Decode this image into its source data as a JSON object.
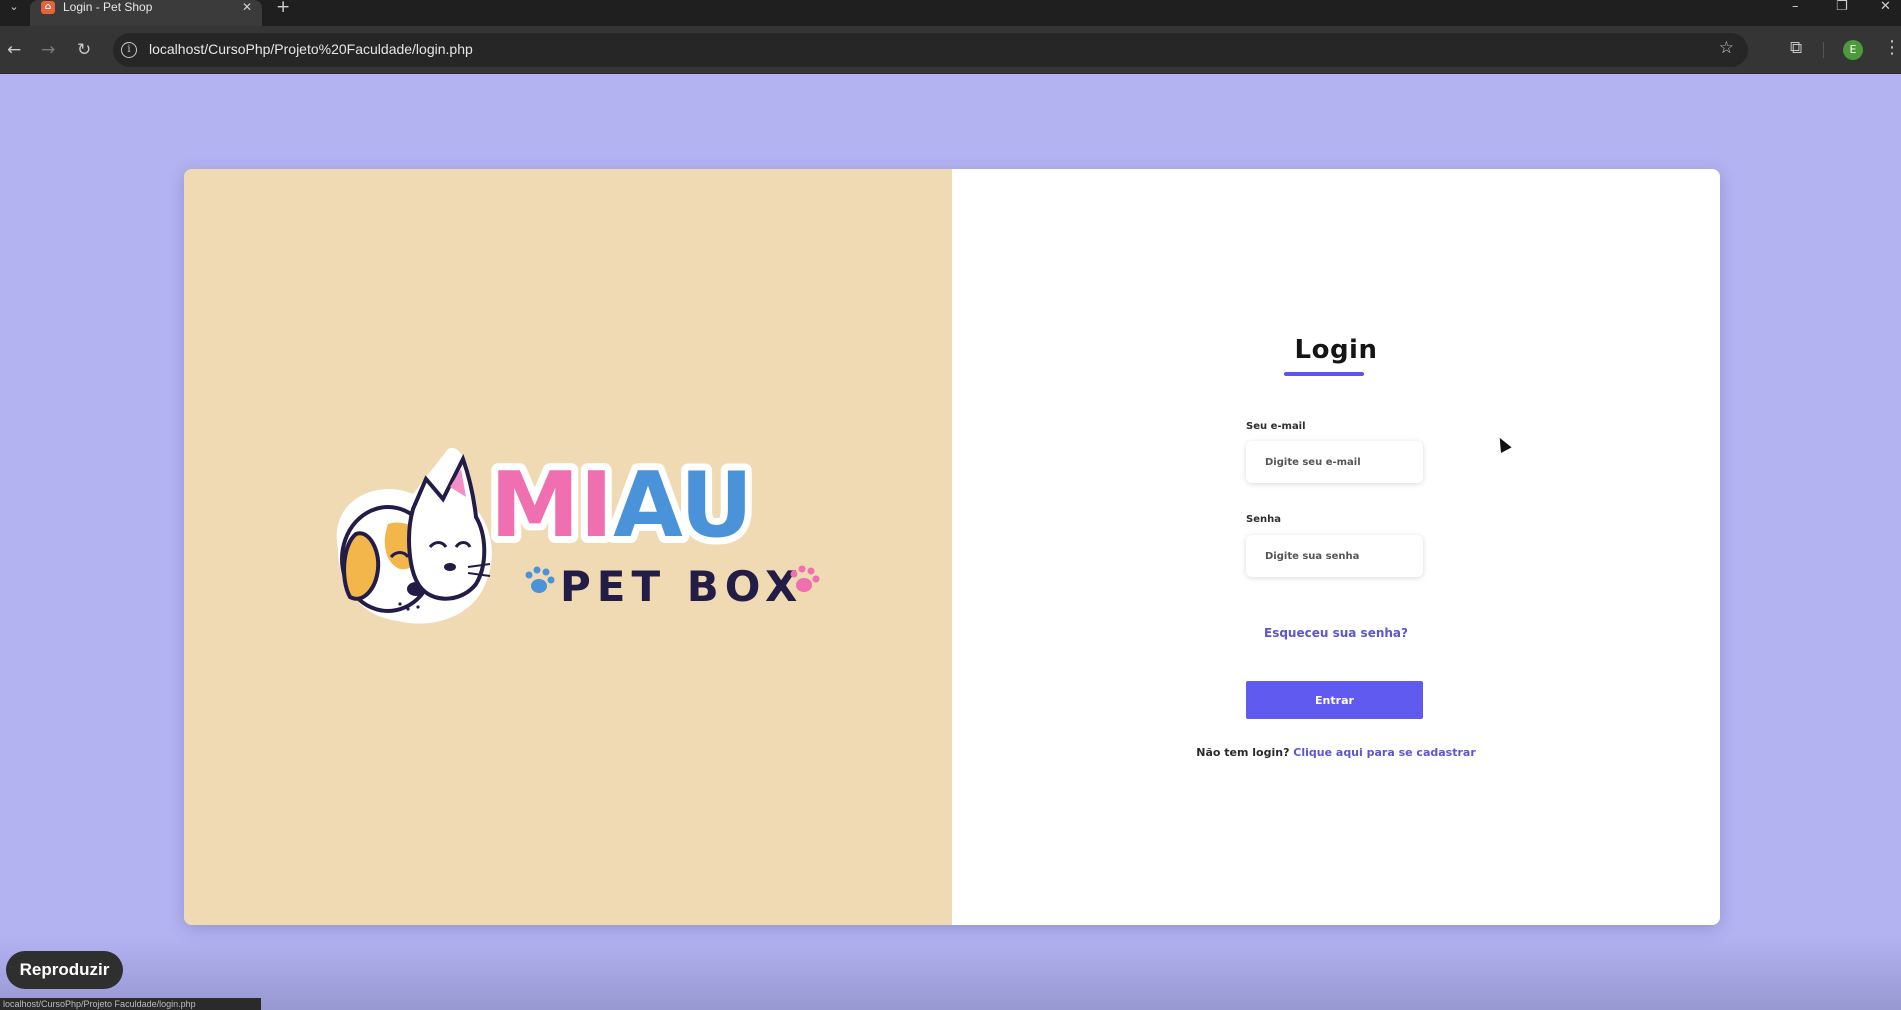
{
  "browser": {
    "tab_title": "Login - Pet Shop",
    "tab_close": "✕",
    "new_tab": "+",
    "url": "localhost/CursoPhp/Projeto%20Faculdade/login.php",
    "profile_initial": "E",
    "status_url": "localhost/CursoPhp/Projeto Faculdade/login.php"
  },
  "logo": {
    "brand_top": "MIAU",
    "brand_bottom": "PET BOX",
    "colors": {
      "pink": "#f06fb0",
      "blue": "#4a93d8",
      "navy": "#231c46",
      "orange": "#f3b64b"
    }
  },
  "login": {
    "title": "Login",
    "email_label": "Seu e-mail",
    "email_placeholder": "Digite seu e-mail",
    "password_label": "Senha",
    "password_placeholder": "Digite sua senha",
    "forgot_link": "Esqueceu sua senha?",
    "submit_label": "Entrar",
    "no_account_text": "Não tem login? ",
    "register_link": "Clique aqui para se cadastrar"
  },
  "overlay": {
    "play_label": "Reproduzir"
  },
  "colors": {
    "page_background": "#b3b3f2",
    "left_panel": "#f0dab3",
    "accent": "#615af0"
  }
}
